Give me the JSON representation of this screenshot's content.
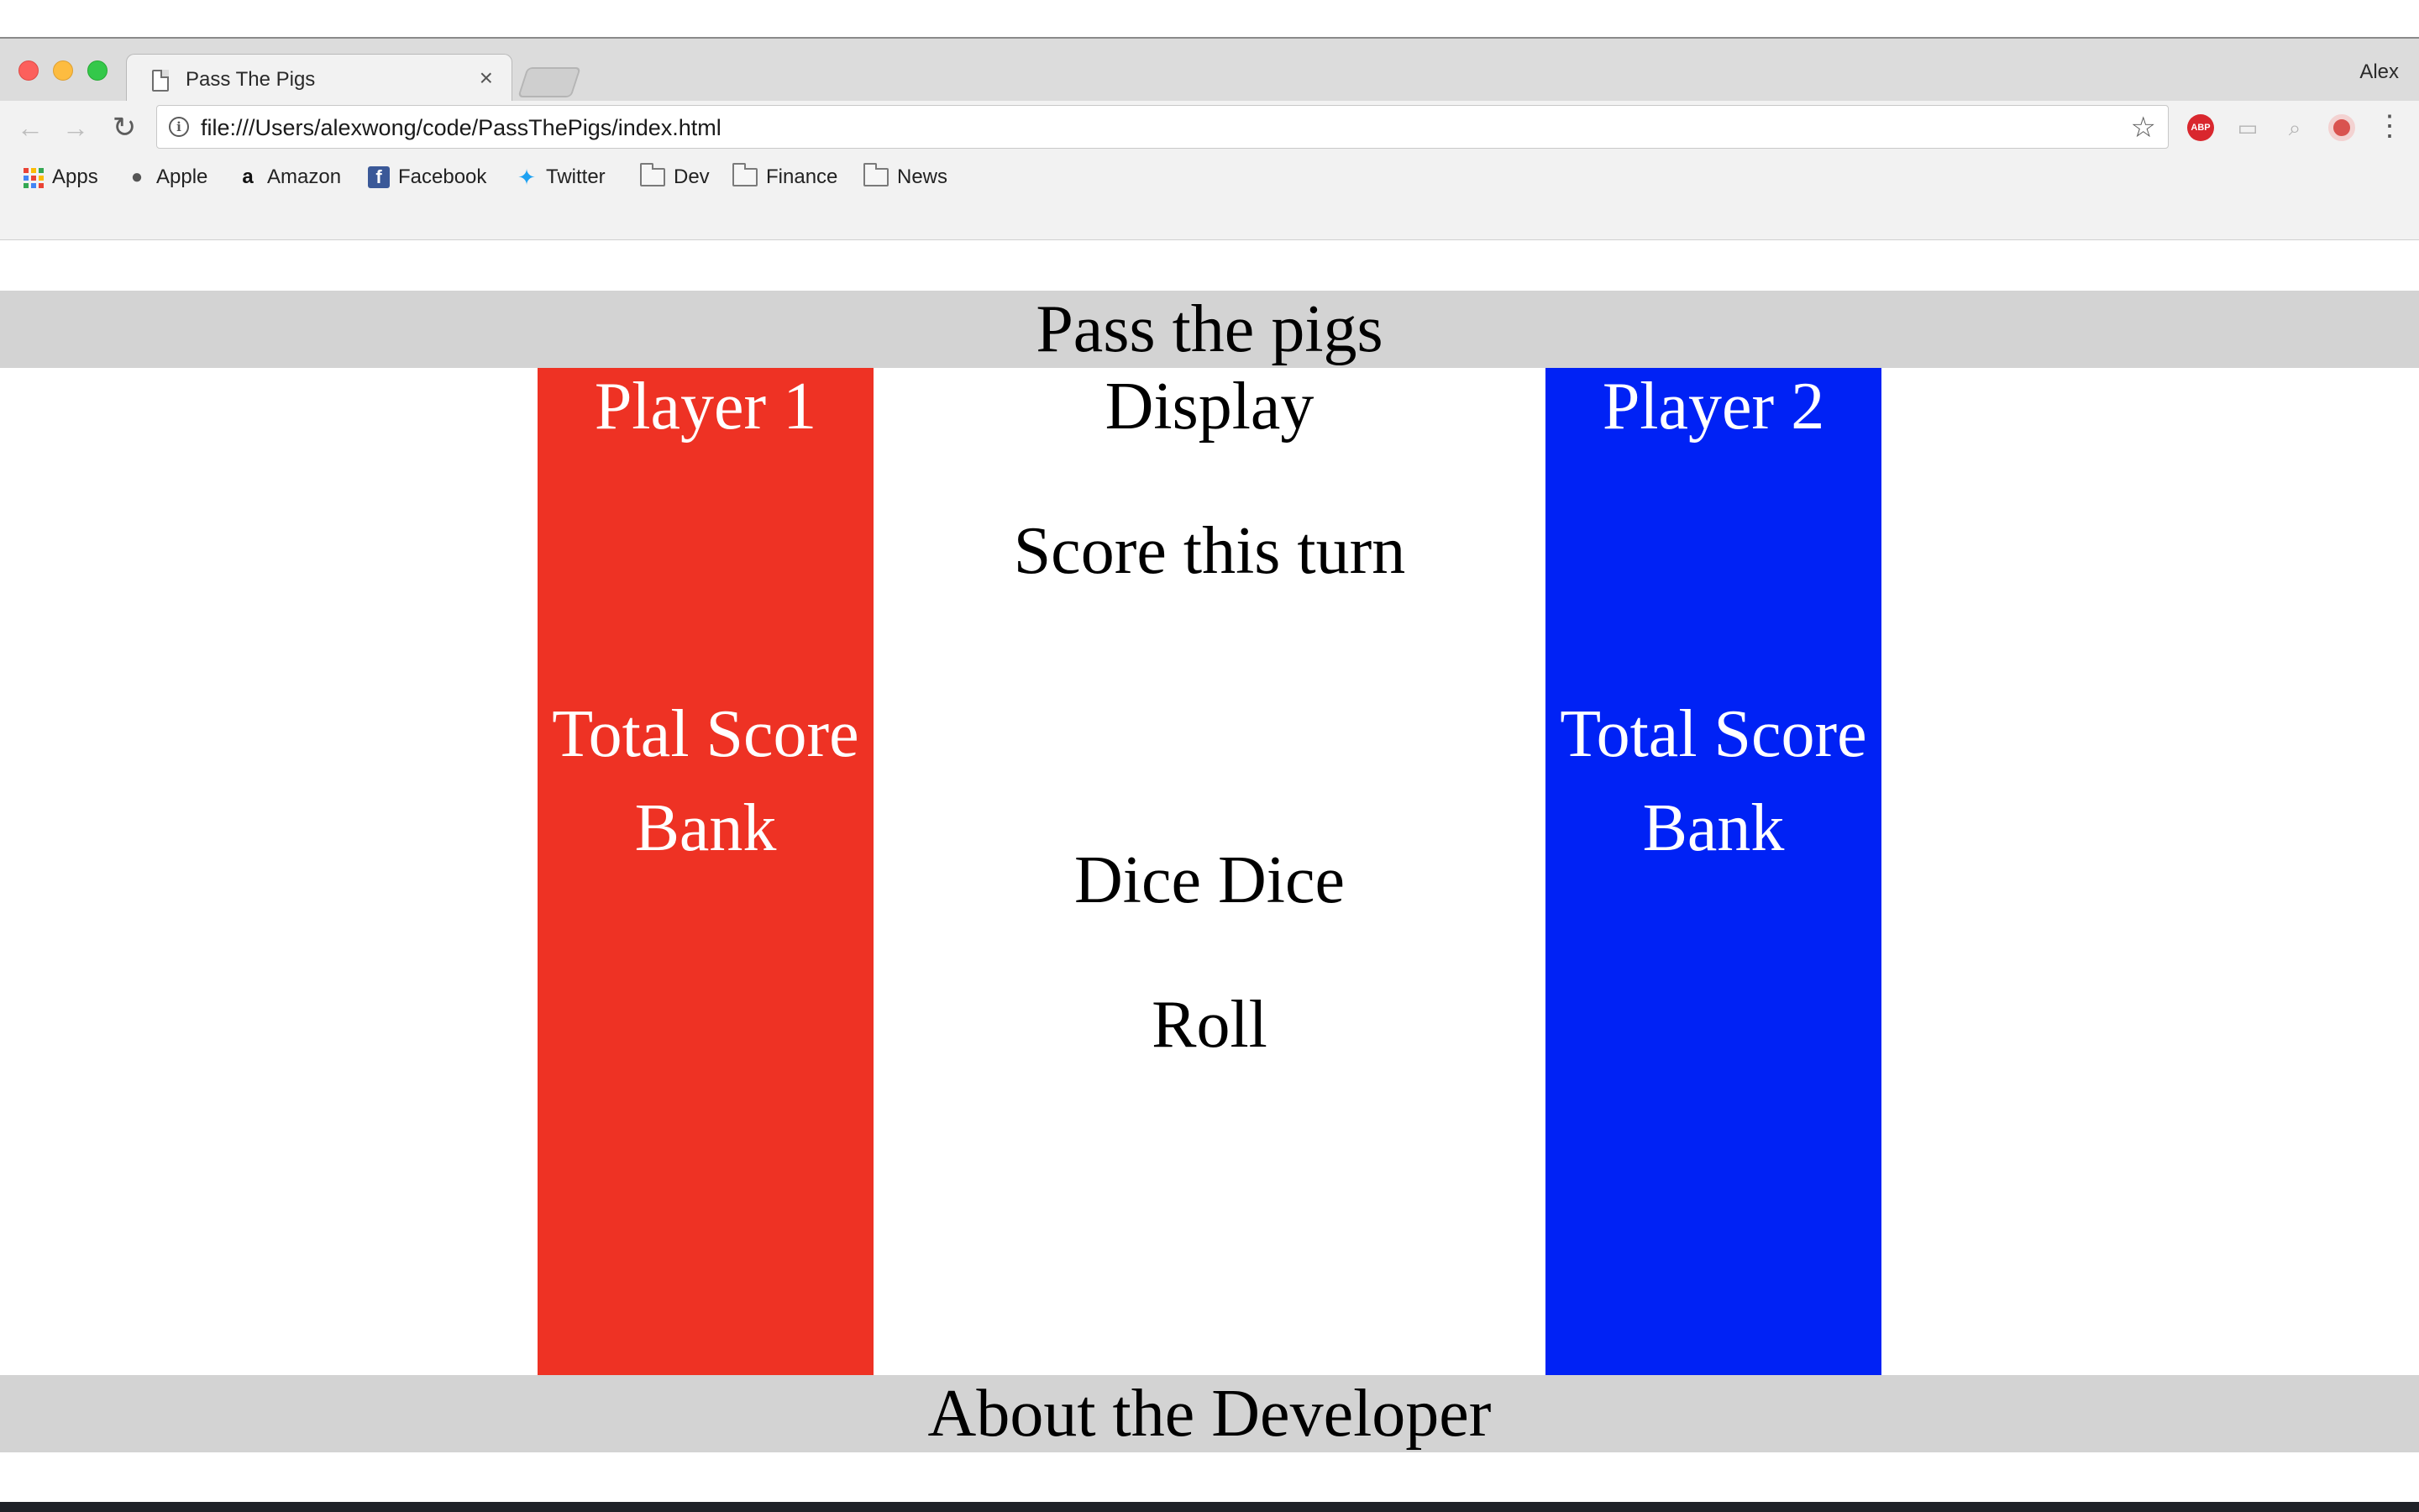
{
  "browser": {
    "tab_title": "Pass The Pigs",
    "tab_close": "×",
    "profile_name": "Alex",
    "url": "file:///Users/alexwong/code/PassThePigs/index.html",
    "abp_label": "ABP",
    "bookmarks": [
      {
        "label": "Apps",
        "icon": "apps-grid-icon"
      },
      {
        "label": "Apple",
        "icon": "apple-icon"
      },
      {
        "label": "Amazon",
        "icon": "amazon-icon"
      },
      {
        "label": "Facebook",
        "icon": "facebook-icon"
      },
      {
        "label": "Twitter",
        "icon": "twitter-icon"
      },
      {
        "label": "Dev",
        "icon": "folder-icon"
      },
      {
        "label": "Finance",
        "icon": "folder-icon"
      },
      {
        "label": "News",
        "icon": "folder-icon"
      }
    ]
  },
  "page": {
    "header": "Pass the pigs",
    "footer": "About the Developer",
    "player1": {
      "title": "Player 1",
      "total_score_label": "Total Score",
      "bank_label": "Bank",
      "color": "#ee3224"
    },
    "player2": {
      "title": "Player 2",
      "total_score_label": "Total Score",
      "bank_label": "Bank",
      "color": "#0022f5"
    },
    "center": {
      "display_label": "Display",
      "score_this_turn": "Score this turn",
      "dice": "Dice Dice",
      "roll_button": "Roll"
    },
    "colors": {
      "bar_gray": "#d3d3d3"
    }
  }
}
